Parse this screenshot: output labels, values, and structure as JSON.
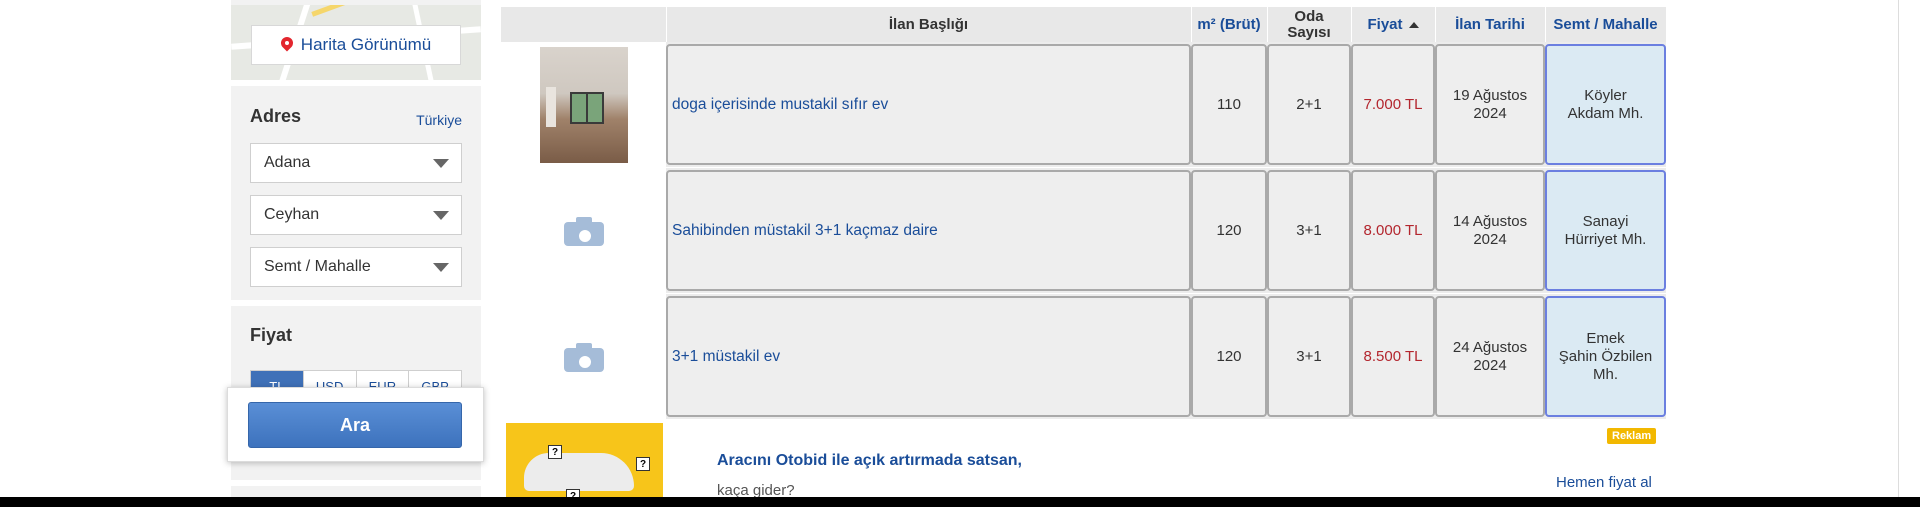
{
  "sidebar": {
    "map_button_label": "Harita Görünümü",
    "address_title": "Adres",
    "country_link": "Türkiye",
    "city_select": "Adana",
    "district_select": "Ceyhan",
    "neighborhood_select": "Semt / Mahalle",
    "price_title": "Fiyat",
    "currencies": [
      "TL",
      "USD",
      "EUR",
      "GBP"
    ],
    "search_button": "Ara"
  },
  "table": {
    "headers": {
      "title": "İlan Başlığı",
      "area": "m² (Brüt)",
      "rooms_line1": "Oda",
      "rooms_line2": "Sayısı",
      "price": "Fiyat",
      "date": "İlan Tarihi",
      "location": "Semt / Mahalle"
    },
    "sort": {
      "column": "price",
      "direction": "ascending"
    },
    "rows": [
      {
        "title": "doga içerisinde mustakil sıfır ev",
        "area": "110",
        "rooms": "2+1",
        "price": "7.000 TL",
        "date_line1": "19 Ağustos",
        "date_line2": "2024",
        "loc_line1": "Köyler",
        "loc_line2": "Akdam Mh.",
        "loc_line3": "",
        "has_photo": true
      },
      {
        "title": "Sahibinden müstakil 3+1 kaçmaz daire",
        "area": "120",
        "rooms": "3+1",
        "price": "8.000 TL",
        "date_line1": "14 Ağustos",
        "date_line2": "2024",
        "loc_line1": "Sanayi",
        "loc_line2": "Hürriyet Mh.",
        "loc_line3": "",
        "has_photo": false
      },
      {
        "title": "3+1 müstakil ev",
        "area": "120",
        "rooms": "3+1",
        "price": "8.500 TL",
        "date_line1": "24 Ağustos",
        "date_line2": "2024",
        "loc_line1": "Emek",
        "loc_line2": "Şahin Özbilen",
        "loc_line3": "Mh.",
        "has_photo": false
      }
    ]
  },
  "ad": {
    "title": "Aracını Otobid ile açık artırmada satsan,",
    "subtitle": "kaça gider?",
    "badge": "Reklam",
    "link": "Hemen fiyat al"
  },
  "colors": {
    "link_blue": "#1a4d99",
    "price_red": "#b3262e",
    "button_blue": "#3d72bd",
    "location_cell_bg": "#dbeaf3",
    "ad_yellow": "#f7c51a"
  }
}
